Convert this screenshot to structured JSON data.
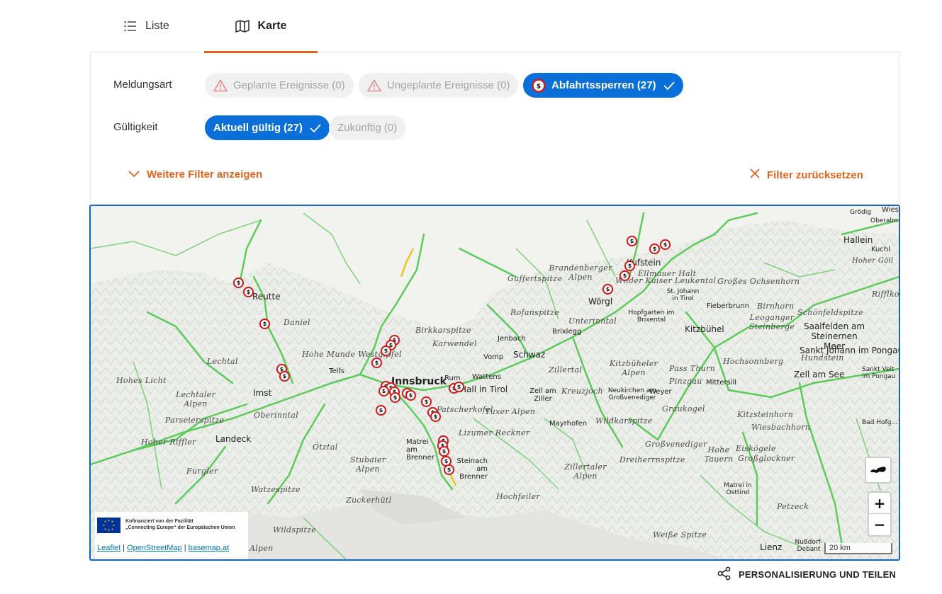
{
  "tabs": {
    "liste": "Liste",
    "karte": "Karte",
    "active": "Karte"
  },
  "filters": {
    "meldungsart_label": "Meldungsart",
    "geplante": "Geplante Ereignisse (0)",
    "ungeplante": "Ungeplante Ereignisse (0)",
    "abfahrtssperren": "Abfahrtssperren (27)",
    "gueltigkeit_label": "Gültigkeit",
    "aktuell": "Aktuell gültig (27)",
    "zukuenftig": "Zukünftig (0)",
    "more_filters": "Weitere Filter anzeigen",
    "reset": "Filter zurücksetzen"
  },
  "map": {
    "labels": {
      "reutte": "Reutte",
      "daniel": "Daniel",
      "lechtal": "Lechtal",
      "hohes_licht": "Hohes Licht",
      "lechtaler_alpen": "Lechtaler Alpen",
      "parseierspitze": "Parseierspitze",
      "hoher_riffler": "Hoher Riffler",
      "landeck": "Landeck",
      "imst": "Imst",
      "oberinntal": "Oberinntal",
      "furgler": "Furgler",
      "watzespitze": "Watzespitze",
      "oetztal": "Ötztal",
      "stubaier_alpen": "Stubaier Alpen",
      "zuckerhuetl": "Zuckerhütl",
      "wildspitze": "Wildspitze",
      "oetztaler_alpen": "Alpen",
      "hohe_munde": "Hohe Munde Westgipfel",
      "telfs": "Telfs",
      "innsbruck": "Innsbruck",
      "birkkarspitze": "Birkkarspitze",
      "karwendel": "Karwendel",
      "rum": "Rum",
      "hall": "Hall in Tirol",
      "patscherkofel": "Patscherkofel",
      "matrei": "Matrei am Brenner",
      "steinach": "Steinach am Brenner",
      "lizumer": "Lizumer Reckner",
      "tuxer": "Tuxer Alpen",
      "jenbach": "Jenbach",
      "vomp": "Vomp",
      "wattens": "Wattens",
      "schwaz": "Schwaz",
      "zillertal": "Zillertal",
      "zell_ziller": "Zell am Ziller",
      "kreuzjoch": "Kreuzjoch",
      "mayrhofen": "Mayrhofen",
      "wildkarspitze": "Wildkarspitze",
      "zillertaler": "Zillertaler Alpen",
      "hochfeiler": "Hochfeiler",
      "rofanspitze": "Rofanspitze",
      "brixlegg": "Brixlegg",
      "unterinntal": "Unterinntal",
      "guffert": "Guffertspitze",
      "brandenberger": "Brandenberger Alpen",
      "kufstein": "Kufstein",
      "ellmauer": "Ellmauer Halt",
      "wilder_kaiser": "Wilder Kaiser",
      "woergl": "Wörgl",
      "hopfgarten": "Hopfgarten im Brixental",
      "st_johann": "St. Johann in Tirol",
      "kitzbuehel": "Kitzbühel",
      "kitzbueheler": "Kitzbüheler Alpen",
      "neukirchen": "Neukirchen am Großvenediger",
      "pass_thurn": "Pass Thurn",
      "grosses_ochsenhorn": "Großes Ochsenhorn",
      "leukental": "Leukental",
      "fieberbrunn": "Fieberbrunn",
      "birnhorn": "Birnhorn",
      "leoganger": "Leoganger Steinberge",
      "schoenfeld": "Schönfeldspitze",
      "saalfelden": "Saalfelden am Steinernen Meer",
      "hundstein": "Hundstein",
      "st_johann_pongau": "Sankt Johann im Pongau",
      "zell_see": "Zell am See",
      "hochsonnberg": "Hochsonnberg",
      "pinzgau": "Pinzgau",
      "mittersill": "Mittersill",
      "weyer": "Weyer",
      "graukogel": "Graukogel",
      "kitzsteinhorn": "Kitzsteinhorn",
      "wiesbachhorn": "Wiesbachhorn",
      "grossvenediger": "Großvenediger",
      "hohe_tauern": "Hohe Tauern",
      "eiskoegele": "Eiskögele",
      "grossglockner": "Großglockner",
      "dreiherrn": "Dreiherrnspitze",
      "matrei_ost": "Matrei in Osttirol",
      "petzeck": "Petzeck",
      "weisse_spitze": "Weiße Spitze",
      "lienz": "Lienz",
      "nussdorf": "Nußdorf-Debant",
      "hallein": "Hallein",
      "kuchl": "Kuchl",
      "riffl": "Rifflkopf",
      "bad_hofgastein": "Bad Hofg...",
      "sankt_veit": "Sankt Veit im Pongau",
      "groedig": "Grödig",
      "oberalm": "Oberalm",
      "hoher_goell": "Hoher Göll",
      "wiese": "Wiese"
    },
    "eu_text_1": "Kofinanziert von der Fazilität",
    "eu_text_2": "„Connecting Europe“ der Europäischen Union",
    "attrib_leaflet": "Leaflet",
    "attrib_osm": "OpenStreetMap",
    "attrib_basemap": "basemap.at",
    "scale": "20 km",
    "marker_symbol": "$",
    "zoom_in": "+",
    "zoom_out": "−"
  },
  "share_label": "PERSONALISIERUNG UND TEILEN",
  "colors": {
    "accent": "#e0631c",
    "primary": "#0a6fd8",
    "marker": "#d31b1b",
    "road": "#4cc84a",
    "map_border": "#1366c9"
  }
}
